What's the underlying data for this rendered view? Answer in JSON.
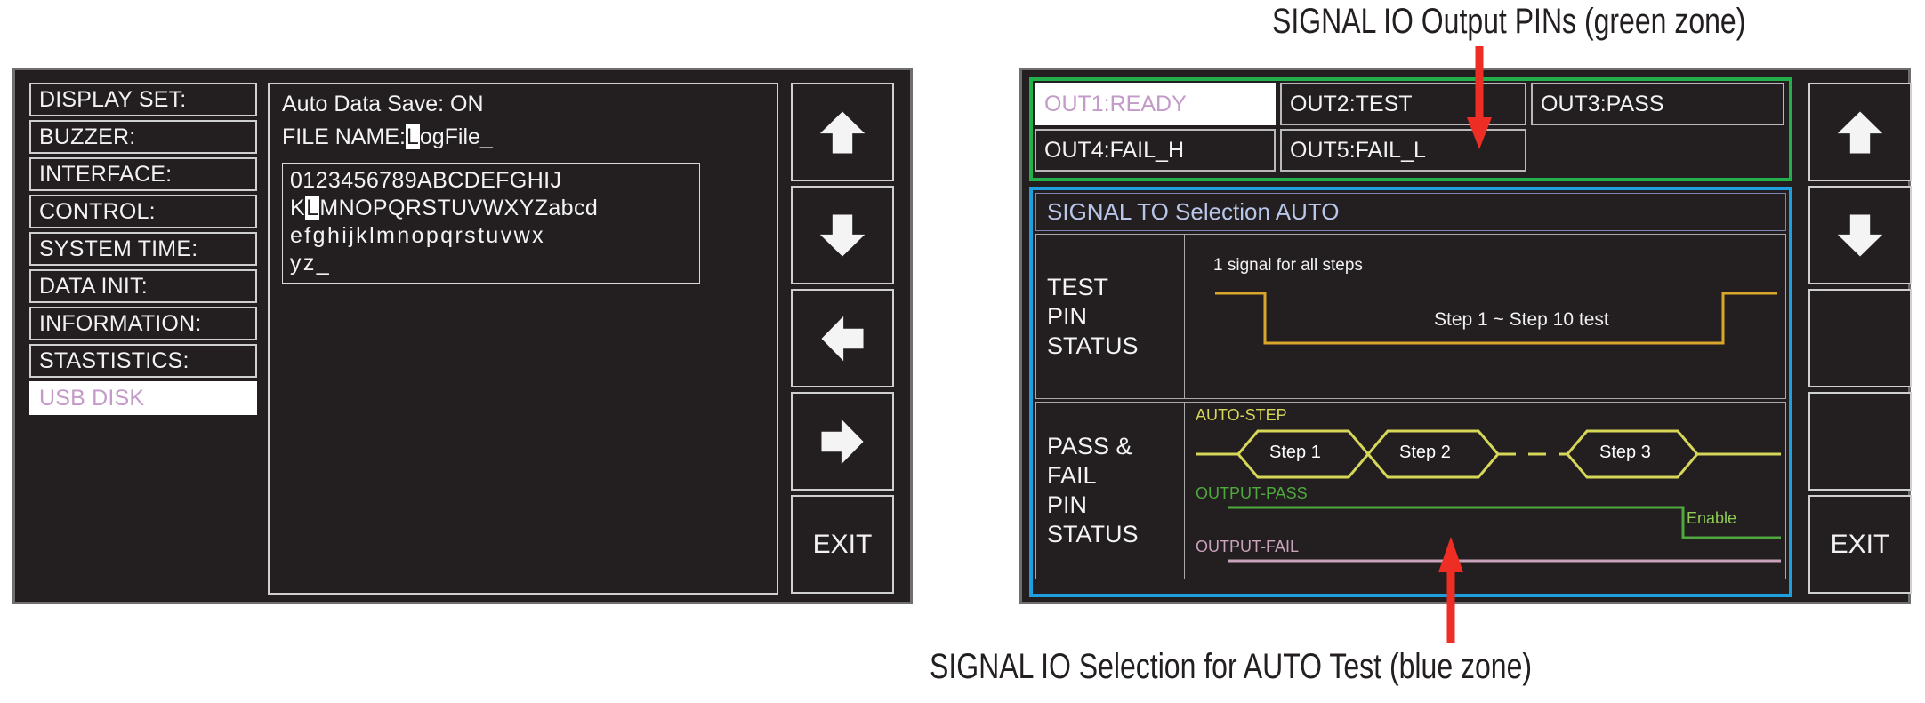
{
  "annotations": {
    "top": "SIGNAL IO Output PINs (green zone)",
    "bottom": "SIGNAL IO Selection for AUTO Test (blue zone)",
    "arrow_color": "#ee2d24"
  },
  "left_screen": {
    "menu": {
      "items": [
        {
          "label": "DISPLAY SET:",
          "selected": false
        },
        {
          "label": "BUZZER:",
          "selected": false
        },
        {
          "label": "INTERFACE:",
          "selected": false
        },
        {
          "label": "CONTROL:",
          "selected": false
        },
        {
          "label": "SYSTEM TIME:",
          "selected": false
        },
        {
          "label": "DATA INIT:",
          "selected": false
        },
        {
          "label": "INFORMATION:",
          "selected": false
        },
        {
          "label": "STASTISTICS:",
          "selected": false
        },
        {
          "label": "USB DISK",
          "selected": true
        }
      ],
      "selected_color": "#c49ac8",
      "selected_bg": "#ffffff"
    },
    "detail": {
      "auto_data_save_label": "Auto Data Save: ON",
      "file_name_label": "FILE NAME:",
      "file_name_cursor_char": "L",
      "file_name_rest": "ogFile_",
      "charset_rows": [
        "0123456789ABCDEFGHIJ",
        "KLMNOPQRSTUVWXYZabcd",
        "efghijklmnopqrstuvwx",
        "yz_"
      ],
      "charset_cursor": {
        "row": 1,
        "index": 1,
        "char": "L"
      }
    },
    "keys": [
      {
        "name": "up-arrow-icon",
        "label": "",
        "icon": "arrow-up"
      },
      {
        "name": "down-arrow-icon",
        "label": "",
        "icon": "arrow-down"
      },
      {
        "name": "left-arrow-icon",
        "label": "",
        "icon": "arrow-left"
      },
      {
        "name": "right-arrow-icon",
        "label": "",
        "icon": "arrow-right"
      },
      {
        "name": "exit-button",
        "label": "EXIT",
        "icon": ""
      }
    ]
  },
  "right_screen": {
    "green_zone": {
      "border_color": "#22b04a",
      "row1": [
        {
          "label": "OUT1:READY",
          "selected": true
        },
        {
          "label": "OUT2:TEST",
          "selected": false
        },
        {
          "label": "OUT3:PASS",
          "selected": false
        }
      ],
      "row2": [
        {
          "label": "OUT4:FAIL_H",
          "selected": false
        },
        {
          "label": "OUT5:FAIL_L",
          "selected": false
        },
        {
          "label": "",
          "selected": false
        }
      ]
    },
    "blue_zone": {
      "border_color": "#1e9fe0",
      "title": "SIGNAL TO Selection AUTO",
      "test_pin": {
        "label_lines": [
          "TEST",
          "PIN",
          "STATUS"
        ],
        "note": "1 signal for all steps",
        "waveform_label": "Step 1 ~ Step 10 test",
        "waveform_color": "#d9a52b"
      },
      "pass_fail_pin": {
        "label_lines": [
          "PASS &",
          "FAIL",
          "PIN",
          "STATUS"
        ],
        "auto_step_label": "AUTO-STEP",
        "auto_step_color": "#d6d658",
        "steps": [
          "Step 1",
          "Step 2",
          "Step 3"
        ],
        "step_gap_dashes": true,
        "output_pass_label": "OUTPUT-PASS",
        "output_pass_color": "#4fa83d",
        "enable_label": "Enable",
        "output_fail_label": "OUTPUT-FAIL",
        "output_fail_color": "#c9a2bb"
      }
    },
    "keys": [
      {
        "name": "up-arrow-icon",
        "label": "",
        "icon": "arrow-up"
      },
      {
        "name": "down-arrow-icon",
        "label": "",
        "icon": "arrow-down"
      },
      {
        "name": "blank-key-1",
        "label": "",
        "icon": ""
      },
      {
        "name": "blank-key-2",
        "label": "",
        "icon": ""
      },
      {
        "name": "exit-button",
        "label": "EXIT",
        "icon": ""
      }
    ]
  }
}
